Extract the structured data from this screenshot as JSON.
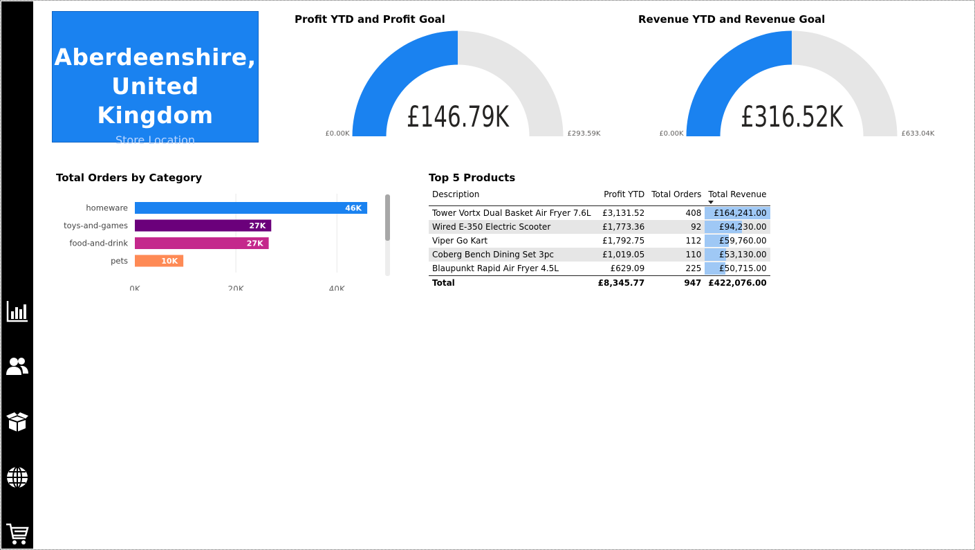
{
  "location": {
    "name_line1": "Aberdeenshire,",
    "name_line2": "United Kingdom",
    "label": "Store Location"
  },
  "profit_gauge": {
    "title": "Profit YTD and Profit Goal",
    "value_label": "£146.79K",
    "min_label": "£0.00K",
    "max_label": "£293.59K",
    "value": 146.79,
    "max": 293.59,
    "fill_color": "#1a82f0",
    "track_color": "#e6e6e6"
  },
  "revenue_gauge": {
    "title": "Revenue YTD and Revenue Goal",
    "value_label": "£316.52K",
    "min_label": "£0.00K",
    "max_label": "£633.04K",
    "value": 316.52,
    "max": 633.04,
    "fill_color": "#1a82f0",
    "track_color": "#e6e6e6"
  },
  "chart_data": {
    "type": "bar",
    "orientation": "horizontal",
    "title": "Total Orders by Category",
    "categories": [
      "homeware",
      "toys-and-games",
      "food-and-drink",
      "pets"
    ],
    "values": [
      46000,
      27000,
      26500,
      9600
    ],
    "data_labels": [
      "46K",
      "27K",
      "27K",
      "10K"
    ],
    "colors": [
      "#1a82f0",
      "#6b007b",
      "#c4288c",
      "#fe8a55"
    ],
    "x_ticks": [
      0,
      20000,
      40000
    ],
    "x_tick_labels": [
      "0K",
      "20K",
      "40K"
    ],
    "xlim": [
      0,
      49000
    ],
    "grid": true,
    "scrollbar": true
  },
  "top_products": {
    "title": "Top 5 Products",
    "columns": [
      "Description",
      "Profit YTD",
      "Total Orders",
      "Total Revenue"
    ],
    "rows": [
      {
        "description": "Tower Vortx Dual Basket Air Fryer 7.6L",
        "profit": "£3,131.52",
        "orders": "408",
        "revenue": "£164,241.00",
        "revenue_value": 164241.0
      },
      {
        "description": "Wired E-350 Electric Scooter",
        "profit": "£1,773.36",
        "orders": "92",
        "revenue": "£94,230.00",
        "revenue_value": 94230.0
      },
      {
        "description": "Viper Go Kart",
        "profit": "£1,792.75",
        "orders": "112",
        "revenue": "£59,760.00",
        "revenue_value": 59760.0
      },
      {
        "description": "Coberg Bench Dining Set 3pc",
        "profit": "£1,019.05",
        "orders": "110",
        "revenue": "£53,130.00",
        "revenue_value": 53130.0
      },
      {
        "description": "Blaupunkt Rapid Air Fryer 4.5L",
        "profit": "£629.09",
        "orders": "225",
        "revenue": "£50,715.00",
        "revenue_value": 50715.0
      }
    ],
    "total": {
      "label": "Total",
      "profit": "£8,345.77",
      "orders": "947",
      "revenue": "£422,076.00"
    },
    "sorted_column": "Total Revenue",
    "databar_color": "#9fc8f5"
  },
  "nav": [
    {
      "name": "nav-chart-icon",
      "icon": "bar-chart"
    },
    {
      "name": "nav-customers-icon",
      "icon": "people"
    },
    {
      "name": "nav-products-icon",
      "icon": "box"
    },
    {
      "name": "nav-geography-icon",
      "icon": "globe"
    },
    {
      "name": "nav-stores-icon",
      "icon": "cart"
    }
  ]
}
